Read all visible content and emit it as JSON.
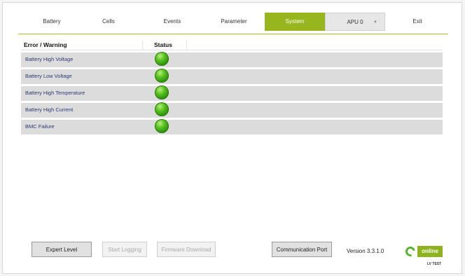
{
  "nav": {
    "tabs": [
      {
        "label": "Battery",
        "active": false
      },
      {
        "label": "Cells",
        "active": false
      },
      {
        "label": "Events",
        "active": false
      },
      {
        "label": "Parameter",
        "active": false
      },
      {
        "label": "System",
        "active": true
      }
    ],
    "unit_select": {
      "value": "APU 0",
      "icon": "chevron-down-icon"
    },
    "exit_label": "Exit"
  },
  "table": {
    "headers": {
      "error": "Error / Warning",
      "status": "Status"
    },
    "rows": [
      {
        "label": "Battery High Voltage",
        "status": "ok"
      },
      {
        "label": "Battery Low Voltage",
        "status": "ok"
      },
      {
        "label": "Battery High Temperature",
        "status": "ok"
      },
      {
        "label": "Battery High Current",
        "status": "ok"
      },
      {
        "label": "BMC Failure",
        "status": "ok"
      }
    ]
  },
  "footer": {
    "expert_level": "Expert Level",
    "start_logging": "Start Logging",
    "firmware_download": "Firmware Download",
    "communication_port": "Communication Port",
    "version": "Version 3.3.1.0",
    "connection_status": "online",
    "connection_sub": "LV TEST"
  },
  "colors": {
    "accent": "#97b51d",
    "status_ok": "#3aa514"
  }
}
